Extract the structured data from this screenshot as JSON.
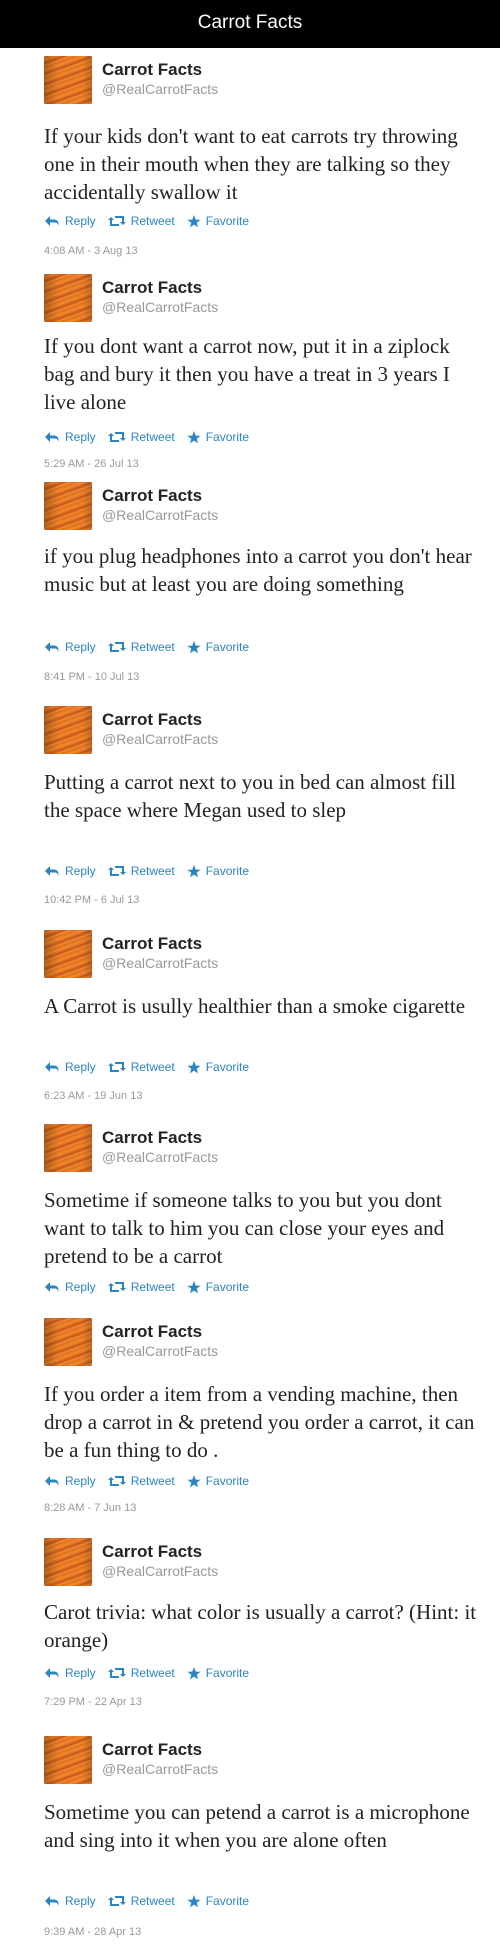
{
  "header": {
    "title": "Carrot Facts"
  },
  "actions": {
    "reply": "Reply",
    "retweet": "Retweet",
    "favorite": "Favorite"
  },
  "tweets": [
    {
      "name": "Carrot Facts",
      "handle": "@RealCarrotFacts",
      "text": "If your kids don't want to eat carrots try throwing one in their mouth when they are talking so they accidentally swallow it",
      "timestamp": "4:08 AM - 3 Aug 13"
    },
    {
      "name": "Carrot Facts",
      "handle": "@RealCarrotFacts",
      "text": "If you dont want a carrot now, put it in a ziplock bag and bury it then you have a treat in 3 years I live alone",
      "timestamp": "5:29 AM - 26 Jul 13"
    },
    {
      "name": "Carrot Facts",
      "handle": "@RealCarrotFacts",
      "text": "if you plug headphones into a carrot you don't hear music but at least you are doing something",
      "timestamp": "8:41 PM - 10 Jul 13"
    },
    {
      "name": "Carrot Facts",
      "handle": "@RealCarrotFacts",
      "text": "Putting a carrot next to you in bed can almost fill the space where Megan used to slep",
      "timestamp": "10:42 PM - 6 Jul 13"
    },
    {
      "name": "Carrot Facts",
      "handle": "@RealCarrotFacts",
      "text": "A Carrot is usully healthier than a smoke cigarette",
      "timestamp": "6:23 AM - 19 Jun 13"
    },
    {
      "name": "Carrot Facts",
      "handle": "@RealCarrotFacts",
      "text": "Sometime if someone talks to you but you dont want to talk to him you can close your eyes and pretend to be a carrot",
      "timestamp": ""
    },
    {
      "name": "Carrot Facts",
      "handle": "@RealCarrotFacts",
      "text": "If you order a item from a vending machine, then drop a carrot in & pretend you order a carrot, it can be a fun thing to do .",
      "timestamp": "8:28 AM - 7 Jun 13"
    },
    {
      "name": "Carrot Facts",
      "handle": "@RealCarrotFacts",
      "text": "Carot trivia: what color is usually a carrot? (Hint: it orange)",
      "timestamp": "7:29 PM - 22 Apr 13"
    },
    {
      "name": "Carrot Facts",
      "handle": "@RealCarrotFacts",
      "text": "Sometime you can petend a carrot is a microphone and sing into it when you are alone often",
      "timestamp": "9:39 AM - 28 Apr 13"
    }
  ],
  "colors": {
    "header_bg": "#000000",
    "action_blue": "#2a84c1",
    "meta_gray": "#999999"
  },
  "icons": {
    "reply": "reply-arrow-icon",
    "retweet": "retweet-icon",
    "favorite": "star-icon",
    "avatar": "carrot-avatar"
  }
}
